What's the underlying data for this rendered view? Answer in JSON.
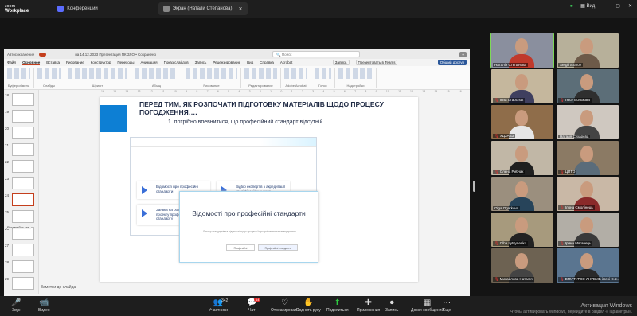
{
  "topbar": {
    "logo_top": "zoom",
    "logo_bottom": "Workplace",
    "tab_conference": "Конференции",
    "tab_screen": "Экран (Натали Степанова)",
    "view": "Вид"
  },
  "ppt": {
    "autosave": "Автосохранение",
    "filename": "на 14.12.2023 Презентация ПК ЗЛО  •  Сохранено",
    "search_placeholder": "Поиск",
    "menu": [
      "Файл",
      "Основное",
      "Вставка",
      "Рисование",
      "Конструктор",
      "Переходы",
      "Анимация",
      "Показ слайдов",
      "Запись",
      "Рецензирование",
      "Вид",
      "Справка",
      "Acrobat"
    ],
    "menu_selected": "Основное",
    "record_btn": "Запись",
    "teams_btn": "Презентовать в Teams",
    "share_btn": "Общий доступ",
    "ribbon_groups": [
      "Буфер обмена",
      "Слайды",
      "Шрифт",
      "Абзац",
      "Рисование",
      "Редактирование",
      "Adobe Acrobat",
      "Голос",
      "Надстройки"
    ],
    "ruler": [
      "16",
      "15",
      "14",
      "13",
      "12",
      "11",
      "10",
      "9",
      "8",
      "7",
      "6",
      "5",
      "4",
      "3",
      "2",
      "1",
      "0",
      "1",
      "2",
      "3",
      "4",
      "5",
      "6",
      "7",
      "8",
      "9",
      "10",
      "11",
      "12",
      "13",
      "14",
      "15",
      "16"
    ],
    "thumbs": [
      "18",
      "19",
      "20",
      "21",
      "22",
      "23",
      "24",
      "25",
      "26",
      "27",
      "28",
      "29"
    ],
    "section_label": "Раздел без заг...",
    "notes_label": "Заметки до слайда",
    "status_left": "Слайд 24 з 46",
    "status_accessibility": "Специальные возможности: проверьте ...",
    "status_zoom": "49%"
  },
  "slide": {
    "title": "ПЕРЕД ТИМ, ЯК РОЗПОЧАТИ ПІДГОТОВКУ МАТЕРІАЛІВ ЩОДО ПРОЦЕСУ ПОГОДЖЕННЯ….",
    "subtitle": "1. потрібно впевнитися, що професійний стандарт відсутній",
    "cards": [
      "Відомості про професійні стандарти",
      "Відбір експертів з акредитації кваліфікаційних цент...",
      "Заявка на розроблення проекту професійного стандарту",
      "Стати акредитованим кваліфікаційним цент..."
    ],
    "popup_title": "Відомості про професійні стандарти",
    "popup_text": "Реєстр стандартів та відомості щодо процесу їх розроблення та затвердження",
    "popup_btn1": "Професійні",
    "popup_btn2": "Професійні стандарти"
  },
  "participants": [
    {
      "name": "Наталія Степанова",
      "mic": false,
      "bg": "#8a8f9e",
      "shirt": "#c0392b",
      "active": true
    },
    {
      "name": "Sergii Sharov",
      "mic": false,
      "bg": "#b7b09a",
      "shirt": "#6d5a49",
      "active": false
    },
    {
      "name": "Inna Grabchuk",
      "mic": true,
      "bg": "#c5b79d",
      "shirt": "#3f3f5f",
      "active": false
    },
    {
      "name": "Леся Волькова",
      "mic": true,
      "bg": "#5c6e78",
      "shirt": "#2f2f2f",
      "active": false
    },
    {
      "name": "УЦЗАВЗ",
      "mic": true,
      "bg": "#8f6d4a",
      "shirt": "#e6e6e6",
      "active": false
    },
    {
      "name": "Наталя Сухарєва",
      "mic": false,
      "bg": "#cfc8c0",
      "shirt": "#444",
      "active": false
    },
    {
      "name": "Олена Рибчак",
      "mic": true,
      "bg": "#c1b7a6",
      "shirt": "#1f1f1f",
      "active": false
    },
    {
      "name": "ЦПТО",
      "mic": true,
      "bg": "#8b7a64",
      "shirt": "#5a6c7a",
      "active": false
    },
    {
      "name": "Olga Ogarkova",
      "mic": false,
      "bg": "#9b8f7e",
      "shirt": "#27445a",
      "active": false
    },
    {
      "name": "Ілона Смолінець",
      "mic": true,
      "bg": "#c9b8a6",
      "shirt": "#8a2a2a",
      "active": false
    },
    {
      "name": "Olha Lytvynenko",
      "mic": true,
      "bg": "#a79a7d",
      "shirt": "#222",
      "active": false
    },
    {
      "name": "Ірина Мяганець",
      "mic": true,
      "bg": "#b2aea6",
      "shirt": "#3a3a3a",
      "active": false
    },
    {
      "name": "Михайлова Наталія",
      "mic": true,
      "bg": "#6d6252",
      "shirt": "#444",
      "active": false
    },
    {
      "name": "ВПУ ТУРКО ЛНУВМБ імені С.З...",
      "mic": true,
      "bg": "#5a7590",
      "shirt": "#2a2a2a",
      "active": false
    }
  ],
  "bottombar": {
    "items": [
      {
        "icon": "🎤",
        "label": "Звук"
      },
      {
        "icon": "📹",
        "label": "Видео"
      },
      {
        "icon": "👥",
        "label": "Участники",
        "count": "342"
      },
      {
        "icon": "💬",
        "label": "Чат",
        "badge": "14"
      },
      {
        "icon": "♡",
        "label": "Отреагировать"
      },
      {
        "icon": "✋",
        "label": "Поднять руку"
      },
      {
        "icon": "⬆",
        "label": "Поделиться"
      },
      {
        "icon": "✚",
        "label": "Приложения"
      },
      {
        "icon": "⏺",
        "label": "Запись"
      },
      {
        "icon": "▦",
        "label": "Доски сообщений"
      },
      {
        "icon": "···",
        "label": "Еще"
      }
    ],
    "leave": "Выйти"
  },
  "windows": {
    "line1": "Активация Windows",
    "line2": "Чтобы активировать Windows, перейдите в раздел «Параметры»."
  }
}
